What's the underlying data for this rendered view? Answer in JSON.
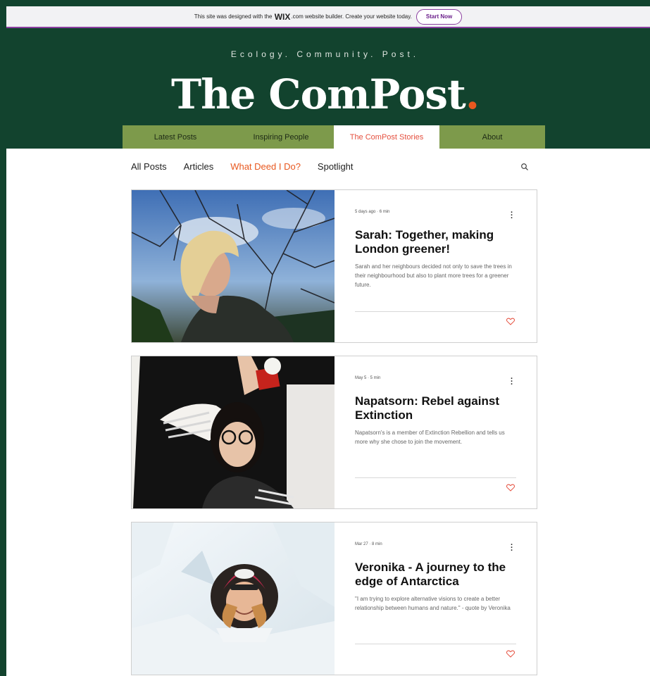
{
  "wix_banner": {
    "text_before": "This site was designed with the",
    "logo": "WIX",
    "text_after": ".com website builder. Create your website today.",
    "button": "Start Now"
  },
  "header": {
    "tagline": "Ecology. Community. Post.",
    "title": "The ComPost",
    "title_dot": "."
  },
  "nav": {
    "items": [
      "Latest Posts",
      "Inspiring People",
      "The ComPost Stories",
      "About"
    ],
    "active": "The ComPost Stories"
  },
  "categories": {
    "items": [
      "All Posts",
      "Articles",
      "What Deed I Do?",
      "Spotlight"
    ],
    "active": "What Deed I Do?"
  },
  "posts": [
    {
      "meta": "5 days ago · 6 min",
      "title": "Sarah: Together, making London greener!",
      "excerpt": "Sarah and her neighbours decided not only to save the trees in their neighbourhood but also to plant more trees for a greener future."
    },
    {
      "meta": "May 5 · 5 min",
      "title": "Napatsorn: Rebel against Extinction",
      "excerpt": "Napatsorn's is a member of Extinction Rebellion and tells us more why she chose to join the movement."
    },
    {
      "meta": "Mar 27 · 8 min",
      "title": "Veronika - A journey to the edge of Antarctica",
      "excerpt": "\"I am trying to explore alternative visions to create a better relationship between humans and nature.\" - quote by Veronika"
    }
  ],
  "colors": {
    "background": "#12432e",
    "nav": "#7d9a4b",
    "accent": "#e8581f",
    "heart": "#e5503f"
  },
  "icons": {
    "search": "search-icon",
    "more": "more-options-icon",
    "like": "heart-icon"
  }
}
